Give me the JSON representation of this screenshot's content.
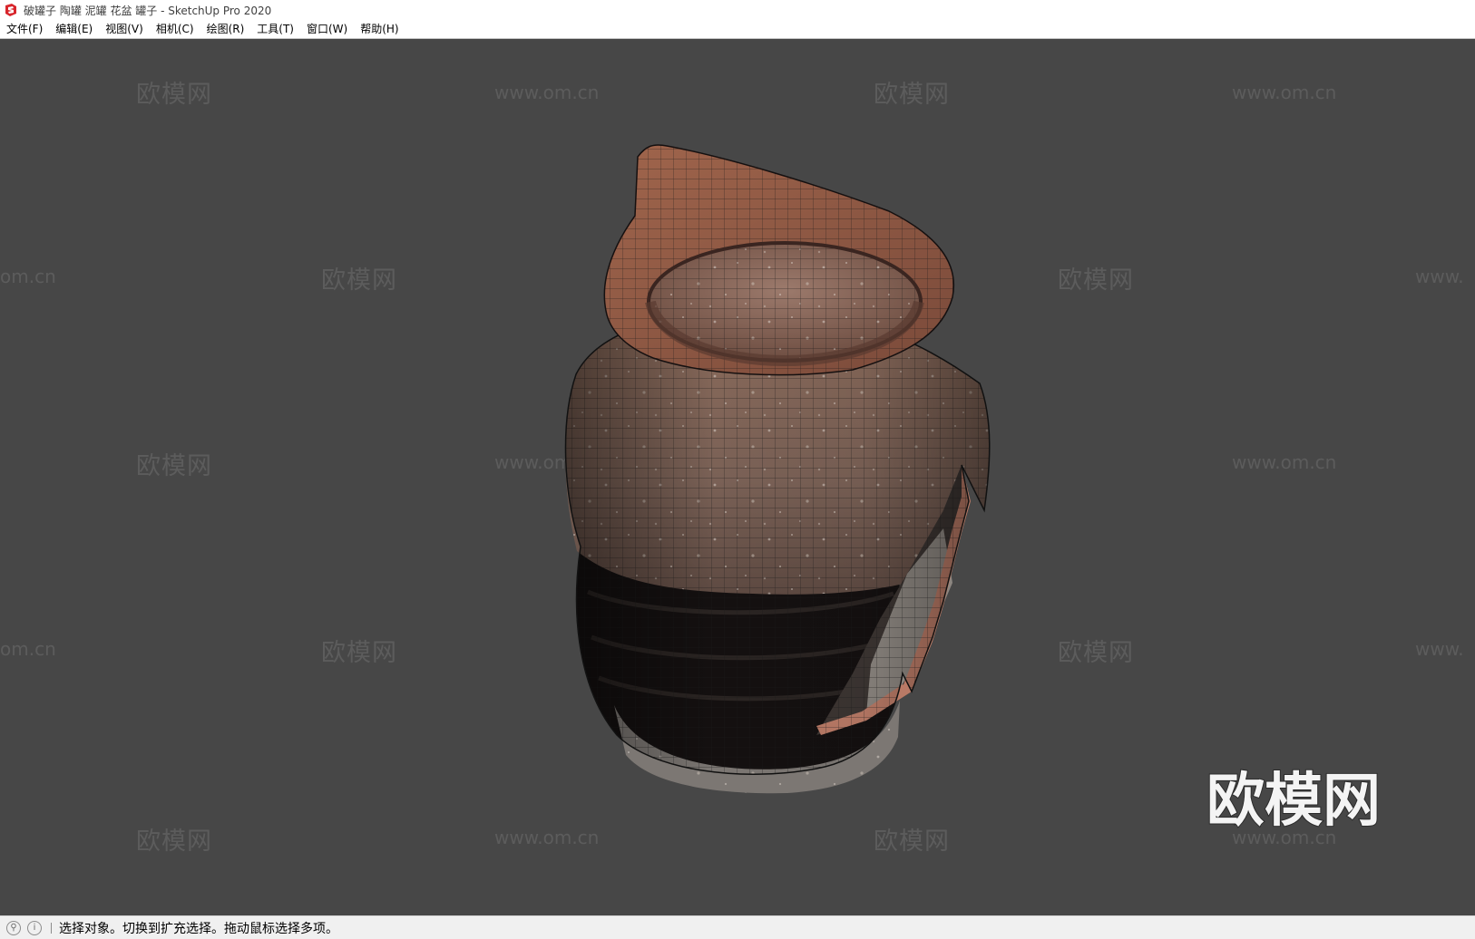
{
  "window": {
    "title": "破罐子 陶罐 泥罐 花盆 罐子 - SketchUp Pro 2020"
  },
  "menu": [
    {
      "label": "文件(F)"
    },
    {
      "label": "编辑(E)"
    },
    {
      "label": "视图(V)"
    },
    {
      "label": "相机(C)"
    },
    {
      "label": "绘图(R)"
    },
    {
      "label": "工具(T)"
    },
    {
      "label": "窗口(W)"
    },
    {
      "label": "帮助(H)"
    }
  ],
  "viewport": {
    "background": "#474747",
    "watermark_cn": "欧模网",
    "watermark_url": "www.om.cn",
    "watermark_url_partial": "om.cn",
    "watermark_url_partial_right": "www.",
    "watermark_big": "欧模网"
  },
  "statusbar": {
    "icons": [
      "geo-location-icon",
      "info-icon"
    ],
    "text": "选择对象。切换到扩充选择。拖动鼠标选择多项。"
  }
}
